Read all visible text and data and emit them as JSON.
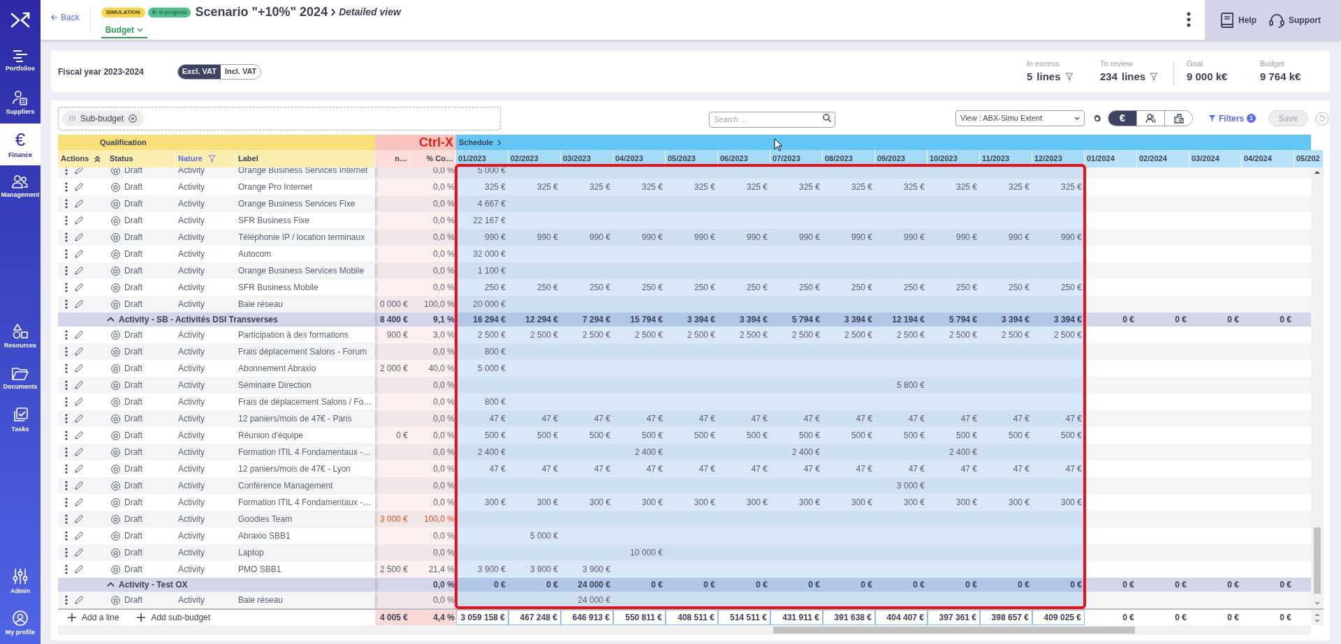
{
  "sidebar": {
    "items": [
      {
        "label": "Portfolios",
        "selected": false
      },
      {
        "label": "Suppliers",
        "selected": false
      },
      {
        "label": "Finance",
        "glyph": "€",
        "selected": true
      },
      {
        "label": "Management",
        "selected": false
      },
      {
        "label": "Resources",
        "selected": false
      },
      {
        "label": "Documents",
        "selected": false
      },
      {
        "label": "Tasks",
        "selected": false
      },
      {
        "label": "Admin",
        "selected": false
      },
      {
        "label": "My profile",
        "selected": false
      }
    ]
  },
  "header": {
    "back": "Back",
    "badges": [
      {
        "label": "SIMULATION",
        "kind": "type"
      },
      {
        "label": "in progress",
        "kind": "status"
      }
    ],
    "title": "Scenario \"+10%\" 2024",
    "subtitle": "Detailed view",
    "tab": "Budget",
    "help": "Help",
    "support": "Support"
  },
  "summary": {
    "fiscal_year": "Fiscal year 2023-2024",
    "vat_options": [
      {
        "label": "Excl. VAT",
        "selected": true
      },
      {
        "label": "Incl. VAT",
        "selected": false
      }
    ],
    "stats": [
      {
        "label": "In excess",
        "value": "5",
        "unit": "lines",
        "filter": true
      },
      {
        "label": "To review",
        "value": "234",
        "unit": "lines",
        "filter": true
      },
      {
        "label": "Goal",
        "value": "9 000 k€",
        "filter": false
      },
      {
        "label": "Budget",
        "value": "9 764 k€",
        "filter": false
      }
    ]
  },
  "toolbar": {
    "chip": "Sub-budget",
    "search": {
      "placeholder": "Search ..."
    },
    "view": "View : ABX-Simu Extent",
    "modes": [
      {
        "glyph": "€",
        "selected": true
      },
      {
        "selected": false
      },
      {
        "selected": false
      }
    ],
    "filters": "Filters",
    "filter_count": "1",
    "save": {
      "label": "Save",
      "disabled": true
    }
  },
  "table": {
    "band": {
      "qualification": "Qualification",
      "annotation": "Ctrl-X",
      "schedule": "Schedule"
    },
    "columns": [
      {
        "label": "Actions",
        "filtered": false
      },
      {
        "label": "Status",
        "filtered": false
      },
      {
        "label": "Nature",
        "filtered": true
      },
      {
        "label": "Label",
        "filtered": false
      },
      {
        "label": "n…",
        "filtered": false
      },
      {
        "label": "% Co…",
        "filtered": false
      }
    ],
    "months": [
      {
        "label": "01/2023",
        "selected": true
      },
      {
        "label": "02/2023",
        "selected": true
      },
      {
        "label": "03/2023",
        "selected": true
      },
      {
        "label": "04/2023",
        "selected": true
      },
      {
        "label": "05/2023",
        "selected": true
      },
      {
        "label": "06/2023",
        "selected": true
      },
      {
        "label": "07/2023",
        "selected": true
      },
      {
        "label": "08/2023",
        "selected": true
      },
      {
        "label": "09/2023",
        "selected": true
      },
      {
        "label": "10/2023",
        "selected": true
      },
      {
        "label": "11/2023",
        "selected": true
      },
      {
        "label": "12/2023",
        "selected": true
      },
      {
        "label": "01/2024",
        "selected": false
      },
      {
        "label": "02/2024",
        "selected": false
      },
      {
        "label": "03/2024",
        "selected": false
      },
      {
        "label": "04/2024",
        "selected": false
      },
      {
        "label": "05/202",
        "selected": false
      }
    ],
    "rows": [
      {
        "kind": "line",
        "status": "Draft",
        "nature": "Activity",
        "label": "Orange Business Services Internet",
        "percent": "0,0 %",
        "over": false,
        "values": {
          "jan_2023": "5 000 €"
        }
      },
      {
        "kind": "line",
        "status": "Draft",
        "nature": "Activity",
        "label": "Orange Pro Internet",
        "percent": "0,0 %",
        "over": false,
        "values": {
          "jan_2023": "325 €",
          "feb_2023": "325 €",
          "mar_2023": "325 €",
          "apr_2023": "325 €",
          "may_2023": "325 €",
          "jun_2023": "325 €",
          "jul_2023": "325 €",
          "aug_2023": "325 €",
          "sep_2023": "325 €",
          "oct_2023": "325 €",
          "nov_2023": "325 €",
          "dec_2023": "325 €"
        }
      },
      {
        "kind": "line",
        "status": "Draft",
        "nature": "Activity",
        "label": "Orange Business Services Fixe",
        "percent": "0,0 %",
        "over": false,
        "values": {
          "jan_2023": "4 667 €"
        }
      },
      {
        "kind": "line",
        "status": "Draft",
        "nature": "Activity",
        "label": "SFR Business Fixe",
        "percent": "0,0 %",
        "over": false,
        "values": {
          "jan_2023": "22 167 €"
        }
      },
      {
        "kind": "line",
        "status": "Draft",
        "nature": "Activity",
        "label": "Téléphonie IP / location terminaux",
        "percent": "0,0 %",
        "over": false,
        "values": {
          "jan_2023": "990 €",
          "feb_2023": "990 €",
          "mar_2023": "990 €",
          "apr_2023": "990 €",
          "may_2023": "990 €",
          "jun_2023": "990 €",
          "jul_2023": "990 €",
          "aug_2023": "990 €",
          "sep_2023": "990 €",
          "oct_2023": "990 €",
          "nov_2023": "990 €",
          "dec_2023": "990 €"
        }
      },
      {
        "kind": "line",
        "status": "Draft",
        "nature": "Activity",
        "label": "Autocom",
        "percent": "0,0 %",
        "over": false,
        "values": {
          "jan_2023": "32 000 €"
        }
      },
      {
        "kind": "line",
        "status": "Draft",
        "nature": "Activity",
        "label": "Orange Business Services Mobile",
        "percent": "0,0 %",
        "over": false,
        "values": {
          "jan_2023": "1 100 €"
        }
      },
      {
        "kind": "line",
        "status": "Draft",
        "nature": "Activity",
        "label": "SFR Business Mobile",
        "percent": "0,0 %",
        "over": false,
        "values": {
          "jan_2023": "250 €",
          "feb_2023": "250 €",
          "mar_2023": "250 €",
          "apr_2023": "250 €",
          "may_2023": "250 €",
          "jun_2023": "250 €",
          "jul_2023": "250 €",
          "aug_2023": "250 €",
          "sep_2023": "250 €",
          "oct_2023": "250 €",
          "nov_2023": "250 €",
          "dec_2023": "250 €"
        }
      },
      {
        "kind": "line",
        "status": "Draft",
        "nature": "Activity",
        "label": "Baie réseau",
        "amount": "0 000 €",
        "percent": "100,0 %",
        "over": false,
        "values": {
          "jan_2023": "20 000 €"
        }
      },
      {
        "kind": "group",
        "label": "Activity - SB - Activités DSI Transverses",
        "expanded": true,
        "amount": "8 400 €",
        "percent": "9,1 %",
        "values": {
          "jan_2023": "16 294 €",
          "feb_2023": "12 294 €",
          "mar_2023": "7 294 €",
          "apr_2023": "15 794 €",
          "may_2023": "3 394 €",
          "jun_2023": "3 394 €",
          "jul_2023": "5 794 €",
          "aug_2023": "3 394 €",
          "sep_2023": "12 194 €",
          "oct_2023": "5 794 €",
          "nov_2023": "3 394 €",
          "dec_2023": "3 394 €",
          "jan_2024": "0 €",
          "feb_2024": "0 €",
          "mar_2024": "0 €",
          "apr_2024": "0 €"
        }
      },
      {
        "kind": "line",
        "status": "Draft",
        "nature": "Activity",
        "label": "Participation à des formations",
        "amount": "900 €",
        "percent": "3,0 %",
        "over": false,
        "values": {
          "jan_2023": "2 500 €",
          "feb_2023": "2 500 €",
          "mar_2023": "2 500 €",
          "apr_2023": "2 500 €",
          "may_2023": "2 500 €",
          "jun_2023": "2 500 €",
          "jul_2023": "2 500 €",
          "aug_2023": "2 500 €",
          "sep_2023": "2 500 €",
          "oct_2023": "2 500 €",
          "nov_2023": "2 500 €",
          "dec_2023": "2 500 €"
        }
      },
      {
        "kind": "line",
        "status": "Draft",
        "nature": "Activity",
        "label": "Frais déplacement Salons - Forum",
        "percent": "0,0 %",
        "over": false,
        "values": {
          "jan_2023": "800 €"
        }
      },
      {
        "kind": "line",
        "status": "Draft",
        "nature": "Activity",
        "label": "Abonnement Abraxio",
        "amount": "2 000 €",
        "percent": "40,0 %",
        "over": false,
        "values": {
          "jan_2023": "5 000 €"
        }
      },
      {
        "kind": "line",
        "status": "Draft",
        "nature": "Activity",
        "label": "Séminaire Direction",
        "percent": "0,0 %",
        "over": false,
        "values": {
          "sep_2023": "5 800 €"
        }
      },
      {
        "kind": "line",
        "status": "Draft",
        "nature": "Activity",
        "label": "Frais de déplacement Salons / Fo…",
        "percent": "0,0 %",
        "over": false,
        "values": {
          "jan_2023": "800 €"
        }
      },
      {
        "kind": "line",
        "status": "Draft",
        "nature": "Activity",
        "label": "12 paniers/mois de 47€ - Paris",
        "percent": "0,0 %",
        "over": false,
        "values": {
          "jan_2023": "47 €",
          "feb_2023": "47 €",
          "mar_2023": "47 €",
          "apr_2023": "47 €",
          "may_2023": "47 €",
          "jun_2023": "47 €",
          "jul_2023": "47 €",
          "aug_2023": "47 €",
          "sep_2023": "47 €",
          "oct_2023": "47 €",
          "nov_2023": "47 €",
          "dec_2023": "47 €"
        }
      },
      {
        "kind": "line",
        "status": "Draft",
        "nature": "Activity",
        "label": "Réunion d'équipe",
        "amount": "0 €",
        "percent": "0,0 %",
        "over": false,
        "values": {
          "jan_2023": "500 €",
          "feb_2023": "500 €",
          "mar_2023": "500 €",
          "apr_2023": "500 €",
          "may_2023": "500 €",
          "jun_2023": "500 €",
          "jul_2023": "500 €",
          "aug_2023": "500 €",
          "sep_2023": "500 €",
          "oct_2023": "500 €",
          "nov_2023": "500 €",
          "dec_2023": "500 €"
        }
      },
      {
        "kind": "line",
        "status": "Draft",
        "nature": "Activity",
        "label": "Formation ITIL 4 Fondamentaux -…",
        "percent": "0,0 %",
        "over": false,
        "values": {
          "jan_2023": "2 400 €",
          "apr_2023": "2 400 €",
          "jul_2023": "2 400 €",
          "oct_2023": "2 400 €"
        }
      },
      {
        "kind": "line",
        "status": "Draft",
        "nature": "Activity",
        "label": "12 paniers/mois de 47€ - Lyon",
        "percent": "0,0 %",
        "over": false,
        "values": {
          "jan_2023": "47 €",
          "feb_2023": "47 €",
          "mar_2023": "47 €",
          "apr_2023": "47 €",
          "may_2023": "47 €",
          "jun_2023": "47 €",
          "jul_2023": "47 €",
          "aug_2023": "47 €",
          "sep_2023": "47 €",
          "oct_2023": "47 €",
          "nov_2023": "47 €",
          "dec_2023": "47 €"
        }
      },
      {
        "kind": "line",
        "status": "Draft",
        "nature": "Activity",
        "label": "Conférence Management",
        "percent": "0,0 %",
        "over": false,
        "values": {
          "sep_2023": "3 000 €"
        }
      },
      {
        "kind": "line",
        "status": "Draft",
        "nature": "Activity",
        "label": "Formation ITIL 4 Fondamentaux -…",
        "percent": "0,0 %",
        "over": false,
        "values": {
          "jan_2023": "300 €",
          "feb_2023": "300 €",
          "mar_2023": "300 €",
          "apr_2023": "300 €",
          "may_2023": "300 €",
          "jun_2023": "300 €",
          "jul_2023": "300 €",
          "aug_2023": "300 €",
          "sep_2023": "300 €",
          "oct_2023": "300 €",
          "nov_2023": "300 €",
          "dec_2023": "300 €"
        }
      },
      {
        "kind": "line",
        "status": "Draft",
        "nature": "Activity",
        "label": "Goodies Team",
        "amount": "3 000 €",
        "percent": "100,0 %",
        "over": true,
        "values": {}
      },
      {
        "kind": "line",
        "status": "Draft",
        "nature": "Activity",
        "label": "Abraxio SBB1",
        "percent": "0,0 %",
        "over": false,
        "values": {
          "feb_2023": "5 000 €"
        }
      },
      {
        "kind": "line",
        "status": "Draft",
        "nature": "Activity",
        "label": "Laptop",
        "percent": "0,0 %",
        "over": false,
        "values": {
          "apr_2023": "10 000 €"
        }
      },
      {
        "kind": "line",
        "status": "Draft",
        "nature": "Activity",
        "label": "PMO SBB1",
        "amount": "2 500 €",
        "percent": "21,4 %",
        "over": false,
        "values": {
          "jan_2023": "3 900 €",
          "feb_2023": "3 900 €",
          "mar_2023": "3 900 €"
        }
      },
      {
        "kind": "group",
        "label": "Activity - Test OX",
        "expanded": true,
        "percent": "0,0 %",
        "values": {
          "jan_2023": "0 €",
          "feb_2023": "0 €",
          "mar_2023": "24 000 €",
          "apr_2023": "0 €",
          "may_2023": "0 €",
          "jun_2023": "0 €",
          "jul_2023": "0 €",
          "aug_2023": "0 €",
          "sep_2023": "0 €",
          "oct_2023": "0 €",
          "nov_2023": "0 €",
          "dec_2023": "0 €",
          "jan_2024": "0 €",
          "feb_2024": "0 €",
          "mar_2024": "0 €",
          "apr_2024": "0 €"
        }
      },
      {
        "kind": "line",
        "status": "Draft",
        "nature": "Activity",
        "label": "Baie réseau",
        "percent": "0,0 %",
        "over": false,
        "values": {
          "mar_2023": "24 000 €"
        }
      }
    ],
    "footer": {
      "add_line": "Add a line",
      "add_sub_budget": "Add sub-budget",
      "amount": "4 005 €",
      "percent": "4,4 %",
      "values": {
        "jan_2023": "3 059 158 €",
        "feb_2023": "467 248 €",
        "mar_2023": "646 913 €",
        "apr_2023": "550 811 €",
        "may_2023": "408 511 €",
        "jun_2023": "514 511 €",
        "jul_2023": "431 911 €",
        "aug_2023": "391 638 €",
        "sep_2023": "404 407 €",
        "oct_2023": "397 361 €",
        "nov_2023": "398 657 €",
        "dec_2023": "409 025 €",
        "jan_2024": "0 €",
        "feb_2024": "0 €",
        "mar_2024": "0 €",
        "apr_2024": "0 €"
      }
    }
  }
}
